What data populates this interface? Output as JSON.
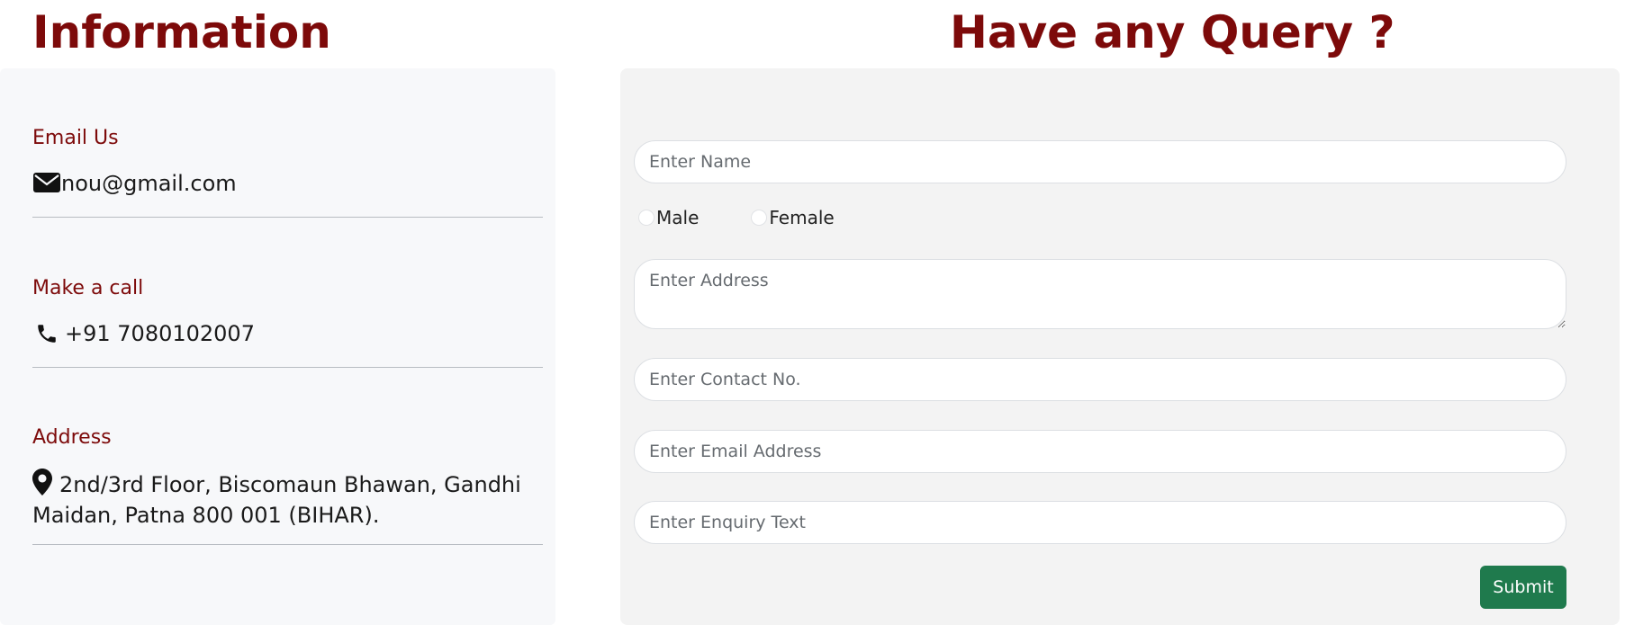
{
  "info": {
    "heading": "Information",
    "email": {
      "label": "Email Us",
      "value": "nou@gmail.com",
      "icon": "envelope-icon"
    },
    "call": {
      "label": "Make a call",
      "value": "+91 7080102007",
      "icon": "phone-icon"
    },
    "address": {
      "label": "Address",
      "value": "2nd/3rd Floor, Biscomaun Bhawan, Gandhi Maidan, Patna 800 001 (BIHAR).",
      "icon": "map-pin-icon"
    }
  },
  "query": {
    "heading": "Have any Query ?",
    "name_placeholder": "Enter Name",
    "gender": {
      "male_label": "Male",
      "female_label": "Female"
    },
    "address_placeholder": "Enter Address",
    "contact_placeholder": "Enter Contact No.",
    "email_placeholder": "Enter Email Address",
    "enquiry_placeholder": "Enter Enquiry Text",
    "submit_label": "Submit"
  },
  "colors": {
    "heading": "#7d0a0a",
    "submit": "#1f7a4d",
    "info_panel_bg": "#f7f8fa",
    "query_panel_bg": "#f3f3f3"
  }
}
